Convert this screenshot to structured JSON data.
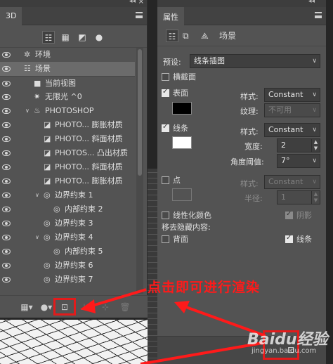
{
  "panel3d": {
    "tab_label": "3D",
    "collapse_arrows": "◂◂",
    "close_glyph": "×",
    "filter_icons": [
      "scene-filter",
      "mesh-filter",
      "material-filter",
      "light-filter"
    ],
    "tree": [
      {
        "label": "环境",
        "icon": "environment-icon",
        "glyph": "✲",
        "indent": 0,
        "twisty": "",
        "eye": true,
        "selected": false
      },
      {
        "label": "场景",
        "icon": "scene-icon",
        "glyph": "☷",
        "indent": 0,
        "twisty": "",
        "eye": true,
        "selected": true
      },
      {
        "label": "当前视图",
        "icon": "camera-icon",
        "glyph": "■",
        "indent": 1,
        "twisty": "",
        "eye": true,
        "selected": false
      },
      {
        "label": "无限光 ^0",
        "icon": "infinite-light-icon",
        "glyph": "✷",
        "indent": 1,
        "twisty": "",
        "eye": true,
        "selected": false
      },
      {
        "label": "PHOTOSHOP",
        "icon": "mesh-icon",
        "glyph": "♨",
        "indent": 1,
        "twisty": "∨",
        "eye": true,
        "selected": false
      },
      {
        "label": "PHOTO... 膨胀材质",
        "icon": "material-icon",
        "glyph": "◪",
        "indent": 2,
        "twisty": "",
        "eye": true,
        "selected": false
      },
      {
        "label": "PHOTO... 斜面材质",
        "icon": "material-icon",
        "glyph": "◪",
        "indent": 2,
        "twisty": "",
        "eye": true,
        "selected": false
      },
      {
        "label": "PHOTOS... 凸出材质",
        "icon": "material-icon",
        "glyph": "◪",
        "indent": 2,
        "twisty": "",
        "eye": true,
        "selected": false
      },
      {
        "label": "PHOTO... 斜面材质",
        "icon": "material-icon",
        "glyph": "◪",
        "indent": 2,
        "twisty": "",
        "eye": true,
        "selected": false
      },
      {
        "label": "PHOTO... 膨胀材质",
        "icon": "material-icon",
        "glyph": "◪",
        "indent": 2,
        "twisty": "",
        "eye": true,
        "selected": false
      },
      {
        "label": "边界约束 1",
        "icon": "constraint-icon",
        "glyph": "◎",
        "indent": 2,
        "twisty": "∨",
        "eye": true,
        "selected": false
      },
      {
        "label": "内部约束 2",
        "icon": "constraint-icon",
        "glyph": "◎",
        "indent": 3,
        "twisty": "",
        "eye": true,
        "selected": false
      },
      {
        "label": "边界约束 3",
        "icon": "constraint-icon",
        "glyph": "◎",
        "indent": 2,
        "twisty": "",
        "eye": true,
        "selected": false
      },
      {
        "label": "边界约束 4",
        "icon": "constraint-icon",
        "glyph": "◎",
        "indent": 2,
        "twisty": "∨",
        "eye": true,
        "selected": false
      },
      {
        "label": "内部约束 5",
        "icon": "constraint-icon",
        "glyph": "◎",
        "indent": 3,
        "twisty": "",
        "eye": true,
        "selected": false
      },
      {
        "label": "边界约束 6",
        "icon": "constraint-icon",
        "glyph": "◎",
        "indent": 2,
        "twisty": "",
        "eye": true,
        "selected": false
      },
      {
        "label": "边界约束 7",
        "icon": "constraint-icon",
        "glyph": "◎",
        "indent": 2,
        "twisty": "",
        "eye": true,
        "selected": false
      }
    ],
    "bottom_icons": [
      "mesh-menu-icon",
      "light-menu-icon",
      "render-icon",
      "add-light-icon",
      "delete-icon"
    ]
  },
  "properties": {
    "tab_label": "属性",
    "scene_label": "场景",
    "preset_label": "预设:",
    "preset_value": "线条插图",
    "cross_section_label": "横截面",
    "cross_section_checked": false,
    "surface": {
      "label": "表面",
      "checked": true,
      "style_label": "样式:",
      "style_value": "Constant",
      "texture_label": "纹理:",
      "texture_value": "不可用",
      "swatch_color": "#000000"
    },
    "lines": {
      "label": "线条",
      "checked": true,
      "style_label": "样式:",
      "style_value": "Constant",
      "width_label": "宽度:",
      "width_value": "2",
      "angle_label": "角度阈值:",
      "angle_value": "7°",
      "swatch_color": "#ffffff"
    },
    "points": {
      "label": "点",
      "checked": false,
      "style_label": "样式:",
      "style_value": "Constant",
      "radius_label": "半径:",
      "radius_value": "1"
    },
    "linearize_label": "线性化颜色",
    "linearize_checked": false,
    "shadow_label": "阴影",
    "shadow_checked": true,
    "remove_hidden_label": "移去隐藏内容:",
    "backface_label": "背面",
    "backface_checked": false,
    "lines_hidden_label": "线条",
    "lines_hidden_checked": true
  },
  "annotation": {
    "callout_text": "点击即可进行渲染",
    "color": "#ff1a1a"
  },
  "watermark": {
    "text": "Baidu经验",
    "subtext": "jingyan.baidu.com"
  }
}
